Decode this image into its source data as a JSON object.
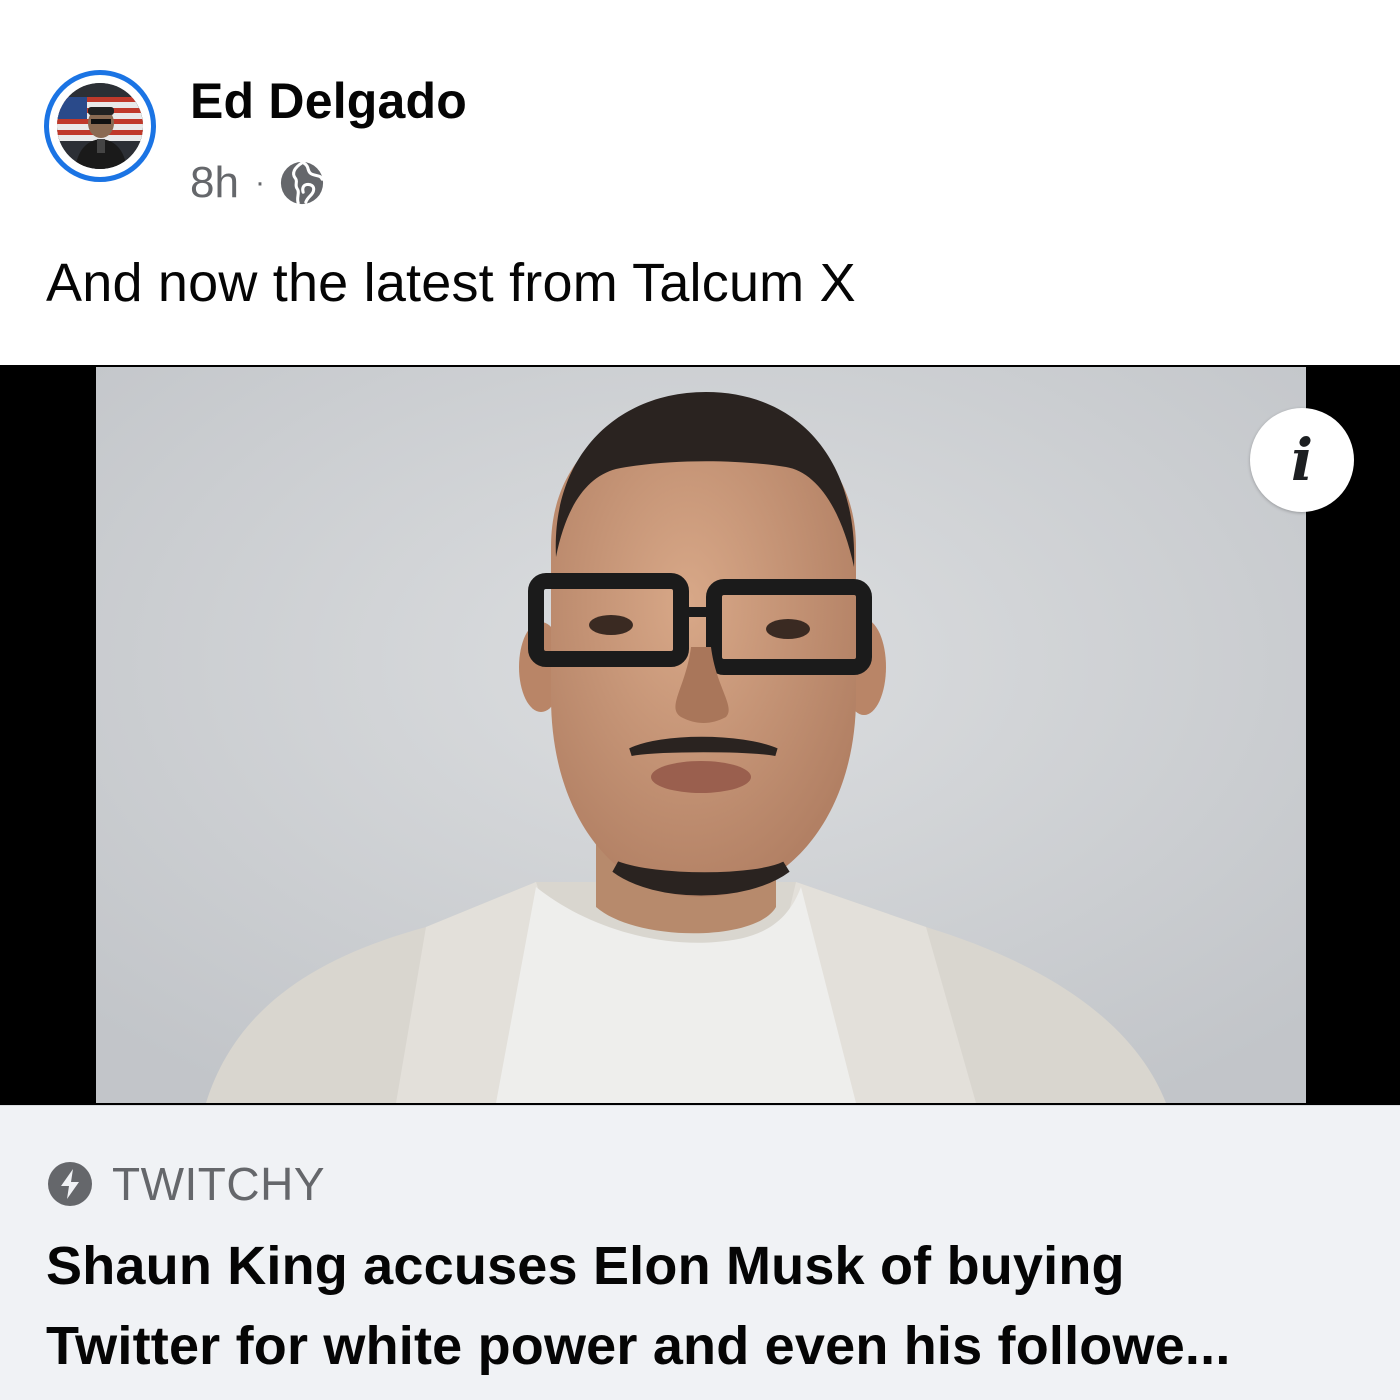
{
  "post": {
    "author": "Ed Delgado",
    "time": "8h",
    "separator": "·",
    "audience_icon": "globe-icon",
    "text": "And now the latest from Talcum X"
  },
  "media": {
    "info_icon": "info-icon",
    "info_glyph": "i"
  },
  "link_preview": {
    "source_icon": "bolt-icon",
    "source": "TWITCHY",
    "headline_line1": "Shaun King accuses Elon Musk of buying",
    "headline_line2": "Twitter for white power and even his followe..."
  },
  "colors": {
    "avatar_ring": "#1b74e4",
    "meta_text": "#65676b",
    "card_background": "#f0f2f5",
    "letterbox": "#000000"
  }
}
